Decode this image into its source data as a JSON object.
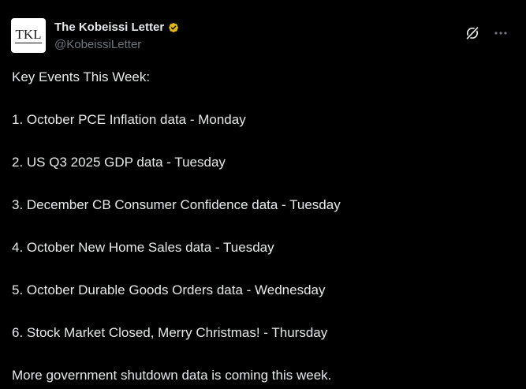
{
  "post": {
    "author": {
      "avatar_text": "TKL",
      "display_name": "The Kobeissi Letter",
      "handle": "@KobeissiLetter",
      "verified_badge_icon": "verified-badge-icon",
      "verified_color": "#e2b719"
    },
    "actions": {
      "grok_icon": "grok-icon",
      "more_icon": "more-options-icon"
    },
    "text": {
      "intro": "Key Events This Week:",
      "items": [
        "1. October PCE Inflation data - Monday",
        "2. US Q3 2025 GDP data - Tuesday",
        "3. December CB Consumer Confidence data - Tuesday",
        "4. October New Home Sales data - Tuesday",
        "5. October Durable Goods Orders data - Wednesday",
        "6. Stock Market Closed, Merry Christmas! - Thursday"
      ],
      "closing": "More government shutdown data is coming this week."
    }
  },
  "colors": {
    "background": "#000000",
    "text_primary": "#e7e9ea",
    "text_secondary": "#71767b"
  }
}
